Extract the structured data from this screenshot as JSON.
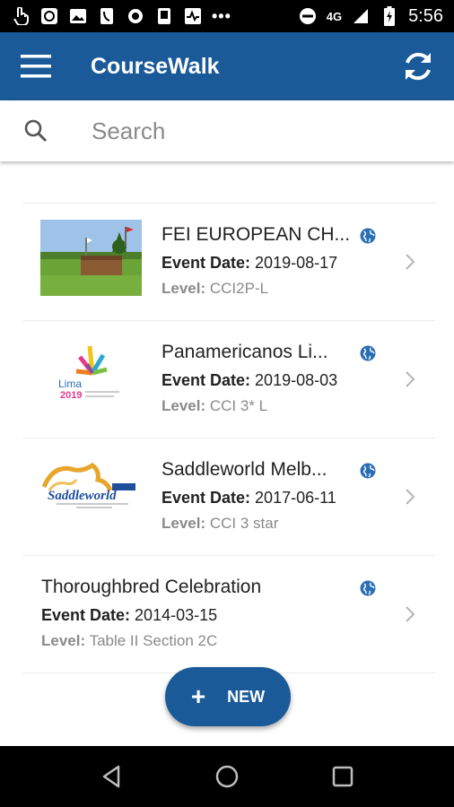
{
  "status_bar": {
    "network": "4G",
    "dots": "•••",
    "time": "5:56"
  },
  "app_bar": {
    "title": "CourseWalk",
    "menu_icon": "hamburger-menu-icon",
    "refresh_icon": "refresh-icon"
  },
  "search": {
    "placeholder": "Search",
    "value": ""
  },
  "events": [
    {
      "name": "FEI EUROPEAN CH...",
      "date_label": "Event Date:",
      "date": "2019-08-17",
      "level_label": "Level:",
      "level": "CCI2P-L",
      "thumb": "photo-cross-country-jump"
    },
    {
      "name": "Panamericanos Li...",
      "date_label": "Event Date:",
      "date": "2019-08-03",
      "level_label": "Level:",
      "level": "CCI 3* L",
      "thumb": "lima-2019-logo",
      "logo_text": "Lima",
      "logo_year": "2019"
    },
    {
      "name": "Saddleworld Melb...",
      "date_label": "Event Date:",
      "date": "2017-06-11",
      "level_label": "Level:",
      "level": "CCI 3 star",
      "thumb": "saddleworld-logo",
      "logo_text": "Saddleworld"
    },
    {
      "name": "Thoroughbred Celebration",
      "date_label": "Event Date:",
      "date": "2014-03-15",
      "level_label": "Level:",
      "level": "Table II Section 2C",
      "thumb": null
    }
  ],
  "fab": {
    "plus": "+",
    "label": "NEW"
  },
  "colors": {
    "primary": "#1a5a99",
    "globe": "#2a6fb5"
  }
}
